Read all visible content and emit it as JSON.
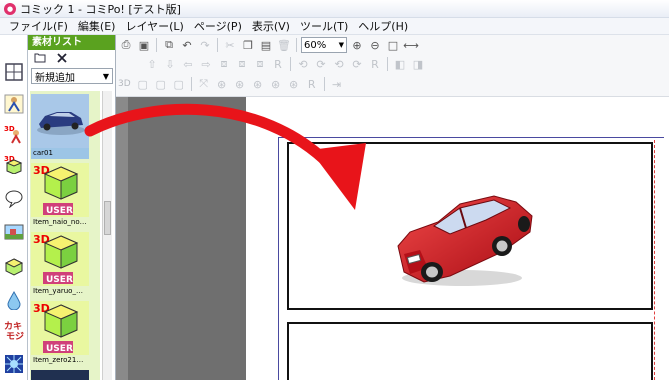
{
  "window": {
    "title": "コミック 1 - コミPo! [テスト版]"
  },
  "menu": [
    "ファイル(F)",
    "編集(E)",
    "レイヤー(L)",
    "ページ(P)",
    "表示(V)",
    "ツール(T)",
    "ヘルプ(H)"
  ],
  "material_panel": {
    "header": "素材リスト",
    "category": "新規追加",
    "items": [
      {
        "label": "car01",
        "selected": true,
        "badge": ""
      },
      {
        "label": "Item_naio_no…",
        "selected": false,
        "badge": "USER"
      },
      {
        "label": "Item_yaruo_…",
        "selected": false,
        "badge": "USER"
      },
      {
        "label": "Item_zero21…",
        "selected": false,
        "badge": "USER"
      }
    ],
    "badge_3d": "3D"
  },
  "toolbar": {
    "zoom": "60%",
    "row3_label": "3D"
  },
  "icon_strip": {
    "moji_label": "カキ\nモジ",
    "badge_3d": "3D"
  },
  "colors": {
    "accent_green": "#5aa21f",
    "thumb_bg": "#e9f7a0",
    "arrow_red": "#e8141a",
    "car_red": "#c8141c"
  }
}
